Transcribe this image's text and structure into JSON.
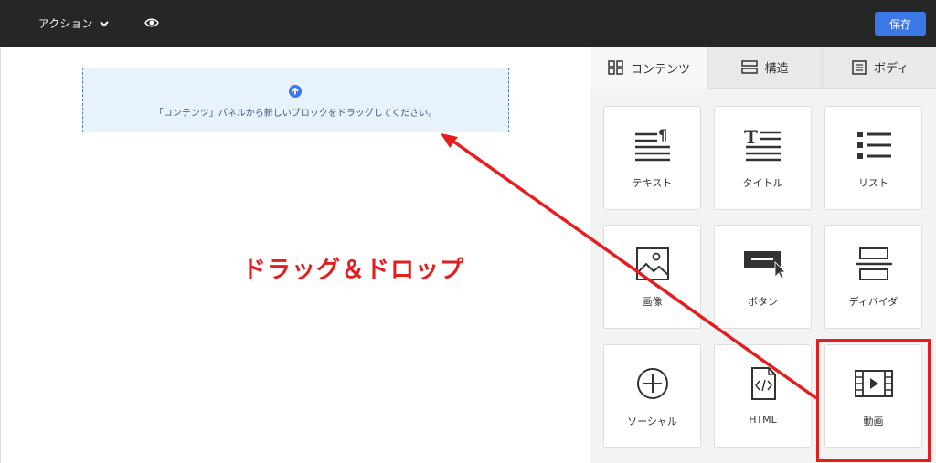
{
  "toolbar": {
    "action_label": "アクション",
    "save_label": "保存"
  },
  "canvas": {
    "drop_text": "「コンテンツ」パネルから新しいブロックをドラッグしてください。",
    "annotation": "ドラッグ＆ドロップ"
  },
  "panel": {
    "tabs": [
      {
        "label": "コンテンツ",
        "icon": "grid-icon"
      },
      {
        "label": "構造",
        "icon": "structure-icon"
      },
      {
        "label": "ボディ",
        "icon": "document-icon"
      }
    ],
    "blocks": [
      {
        "label": "テキスト",
        "icon": "text-icon"
      },
      {
        "label": "タイトル",
        "icon": "title-icon"
      },
      {
        "label": "リスト",
        "icon": "list-icon"
      },
      {
        "label": "画像",
        "icon": "image-icon"
      },
      {
        "label": "ボタン",
        "icon": "button-icon"
      },
      {
        "label": "ディバイダ",
        "icon": "divider-icon"
      },
      {
        "label": "ソーシャル",
        "icon": "social-icon"
      },
      {
        "label": "HTML",
        "icon": "html-icon"
      },
      {
        "label": "動画",
        "icon": "video-icon"
      }
    ]
  },
  "colors": {
    "topbar": "#262626",
    "accent": "#3b78e7",
    "annotation": "#e41e1e",
    "drop_zone_bg": "#e8f2fc"
  }
}
